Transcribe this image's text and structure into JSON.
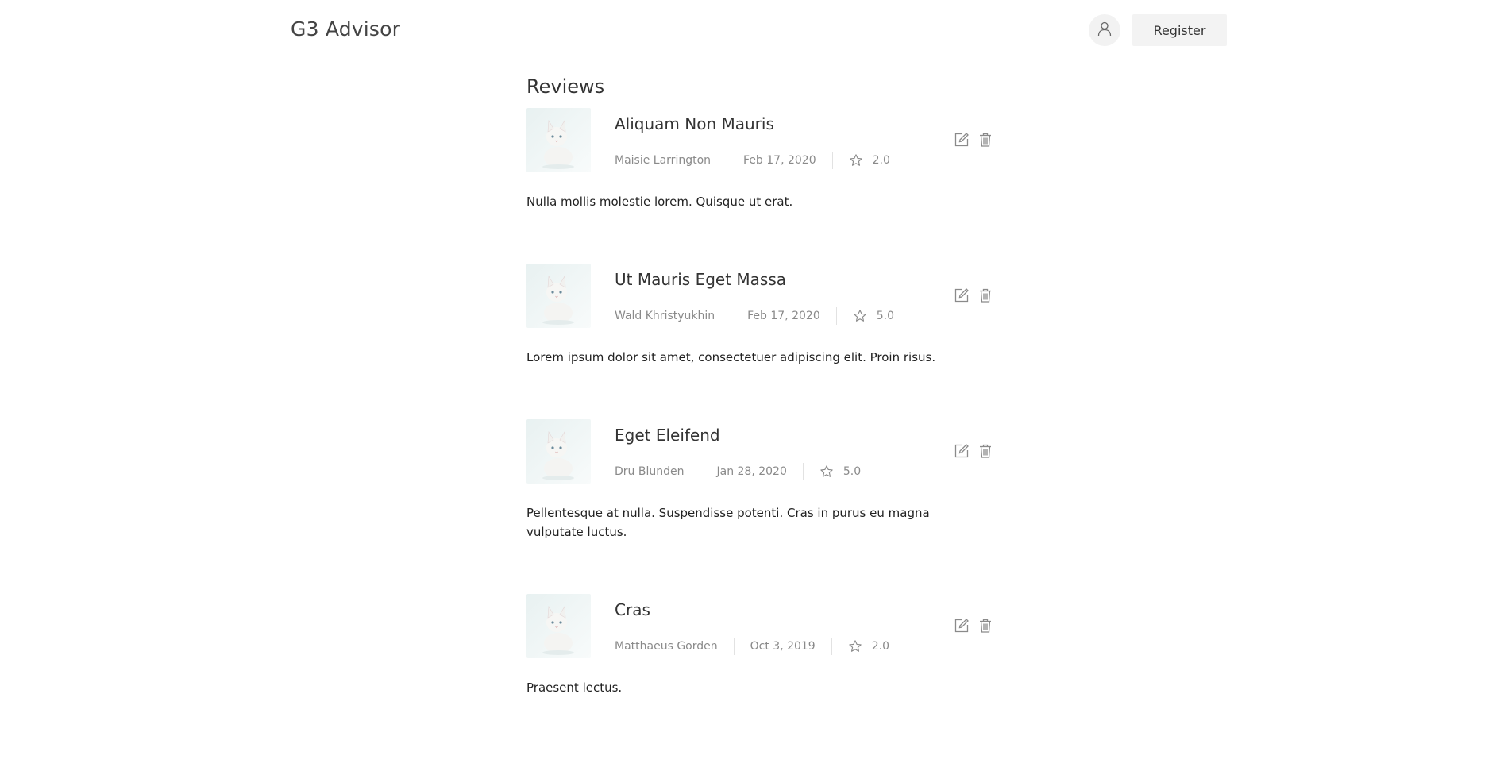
{
  "header": {
    "brand": "G3 Advisor",
    "register_label": "Register",
    "user_icon": "user-icon"
  },
  "main": {
    "title": "Reviews",
    "reviews": [
      {
        "title": "Aliquam Non Mauris",
        "author": "Maisie Larrington",
        "date": "Feb 17, 2020",
        "rating": "2.0",
        "body": "Nulla mollis molestie lorem. Quisque ut erat."
      },
      {
        "title": "Ut Mauris Eget Massa",
        "author": "Wald Khristyukhin",
        "date": "Feb 17, 2020",
        "rating": "5.0",
        "body": "Lorem ipsum dolor sit amet, consectetuer adipiscing elit. Proin risus."
      },
      {
        "title": "Eget Eleifend",
        "author": "Dru Blunden",
        "date": "Jan 28, 2020",
        "rating": "5.0",
        "body": "Pellentesque at nulla. Suspendisse potenti. Cras in purus eu magna vulputate luctus."
      },
      {
        "title": "Cras",
        "author": "Matthaeus Gorden",
        "date": "Oct 3, 2019",
        "rating": "2.0",
        "body": "Praesent lectus."
      }
    ]
  },
  "colors": {
    "text": "#222222",
    "muted": "#8a8a8a",
    "button_bg": "#f3f3f3",
    "icon": "#8a8a8a"
  }
}
